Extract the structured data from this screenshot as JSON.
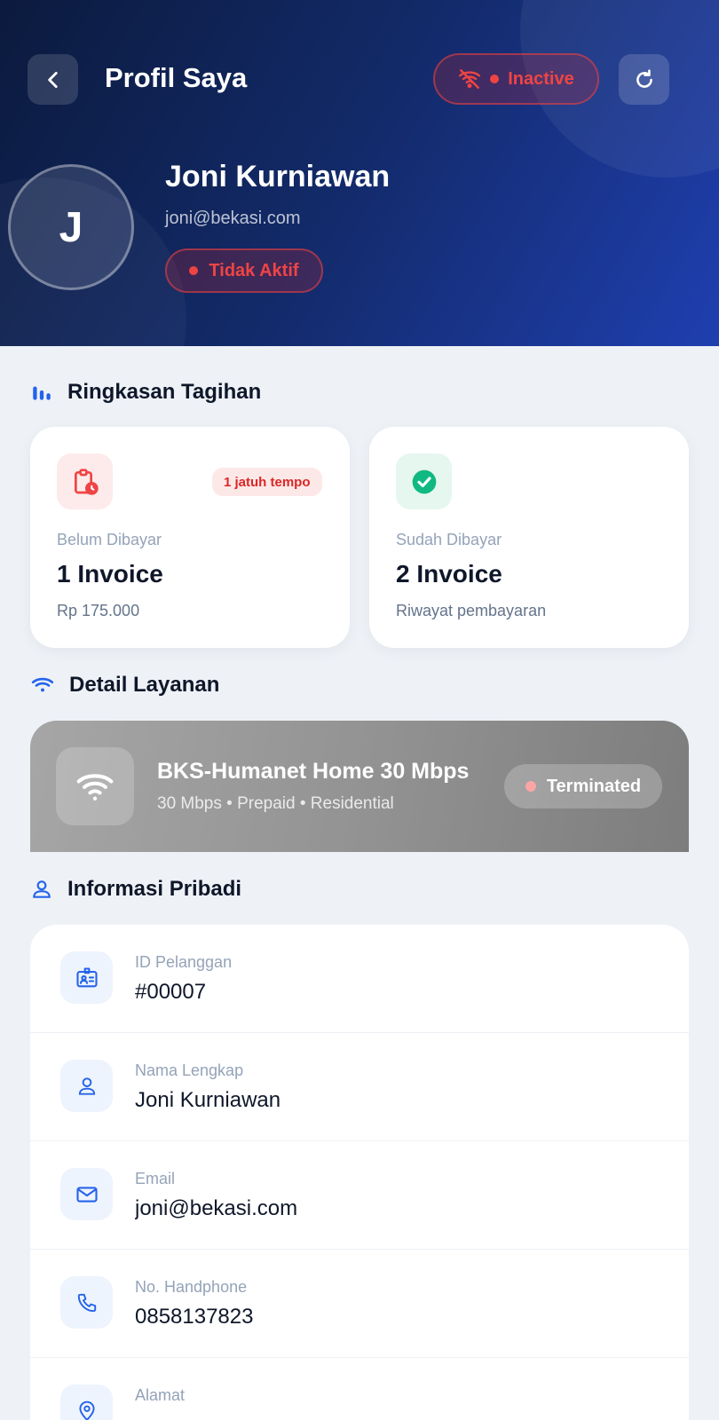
{
  "header": {
    "title": "Profil Saya",
    "connection_status": "Inactive",
    "user": {
      "initial": "J",
      "name": "Joni Kurniawan",
      "email": "joni@bekasi.com",
      "status": "Tidak Aktif"
    }
  },
  "billing": {
    "section_title": "Ringkasan Tagihan",
    "unpaid": {
      "badge": "1 jatuh tempo",
      "label": "Belum Dibayar",
      "value": "1 Invoice",
      "sub": "Rp 175.000"
    },
    "paid": {
      "label": "Sudah Dibayar",
      "value": "2 Invoice",
      "sub": "Riwayat pembayaran"
    }
  },
  "service": {
    "section_title": "Detail Layanan",
    "name": "BKS-Humanet Home 30 Mbps",
    "details": "30 Mbps • Prepaid • Residential",
    "status": "Terminated"
  },
  "personal": {
    "section_title": "Informasi Pribadi",
    "rows": [
      {
        "label": "ID Pelanggan",
        "value": "#00007",
        "icon": "id-card-icon"
      },
      {
        "label": "Nama Lengkap",
        "value": "Joni Kurniawan",
        "icon": "user-icon"
      },
      {
        "label": "Email",
        "value": "joni@bekasi.com",
        "icon": "mail-icon"
      },
      {
        "label": "No. Handphone",
        "value": "0858137823",
        "icon": "phone-icon"
      },
      {
        "label": "Alamat",
        "value": "",
        "icon": "location-pin-icon"
      }
    ]
  },
  "colors": {
    "header_start": "#0b1a3d",
    "header_end": "#1f3fb0",
    "inactive_red": "#ef4444",
    "paid_green": "#10b981",
    "accent_blue": "#2563eb",
    "page_bg": "#eef2f7"
  }
}
